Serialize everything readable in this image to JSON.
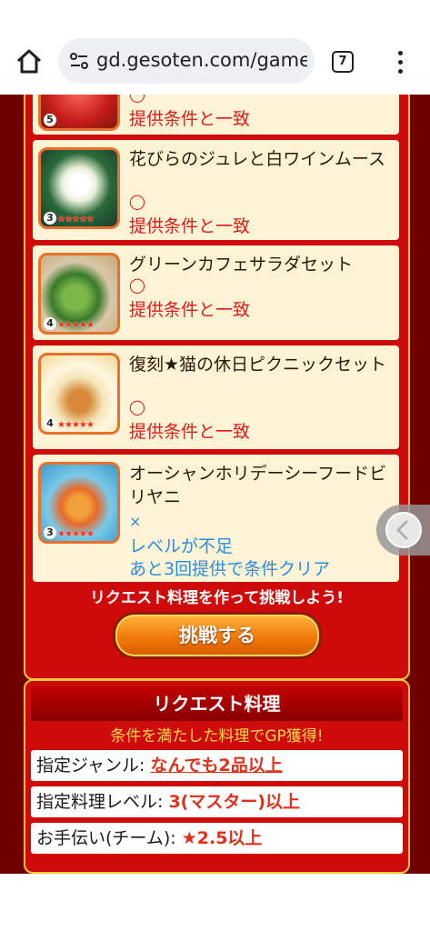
{
  "browser": {
    "url": "gd.gesoten.com/games",
    "tab_count": "7",
    "icons": [
      "home-icon",
      "site-settings-icon",
      "more-vert-icon"
    ]
  },
  "items": [
    {
      "name": "",
      "level": "5",
      "stars": "★★★★★",
      "mark": "◯",
      "status": "提供条件と一致"
    },
    {
      "name": "花びらのジュレと白ワインムース",
      "level": "3",
      "stars": "★★★★★",
      "mark": "◯",
      "status": "提供条件と一致"
    },
    {
      "name": "グリーンカフェサラダセット",
      "level": "4",
      "stars": "★★★★★",
      "mark": "◯",
      "status": "提供条件と一致"
    },
    {
      "name": "復刻★猫の休日ピクニックセット",
      "level": "4",
      "stars": "★★★★★",
      "mark": "◯",
      "status": "提供条件と一致"
    },
    {
      "name": "オーシャンホリデーシーフードビリヤニ",
      "level": "3",
      "stars": "★★★★★",
      "mark": "×",
      "status": "レベルが不足",
      "hint": "あと3回提供で条件クリア"
    }
  ],
  "cta": {
    "text": "リクエスト料理を作って挑戦しよう!",
    "button": "挑戦する"
  },
  "request": {
    "title": "リクエスト料理",
    "subtitle": "条件を満たした料理でGP獲得!",
    "rows": [
      {
        "label": "指定ジャンル:",
        "value": "なんでも2品以上"
      },
      {
        "label": "指定料理レベル:",
        "value": "3(マスター)以上"
      },
      {
        "label": "お手伝い(チーム):",
        "value": "★2.5以上"
      }
    ]
  },
  "colors": {
    "panel": "#cf0a0a",
    "border": "#f2c83a",
    "card": "#fff3d6",
    "ok": "#e01a1a",
    "ng": "#2a8de0"
  }
}
